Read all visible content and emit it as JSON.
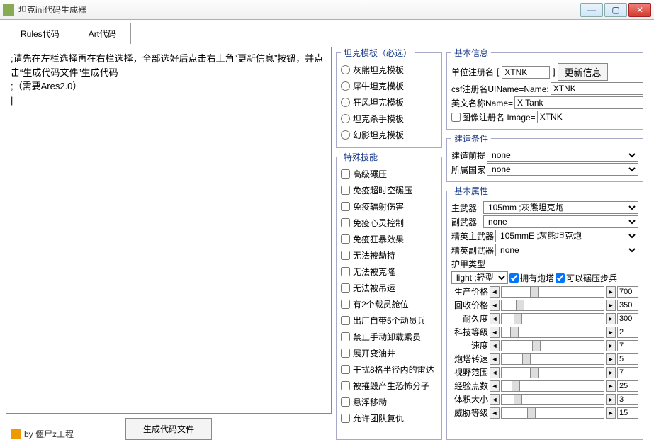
{
  "window": {
    "title": "坦克ini代码生成器"
  },
  "tabs": [
    "Rules代码",
    "Art代码"
  ],
  "editor_text": ";请先在左栏选择再在右栏选择，全部选好后点击右上角“更新信息”按钮，并点击“生成代码文件”生成代码\n;（需要Ares2.0）\n|",
  "generate_btn": "生成代码文件",
  "byline": "by 僵尸z工程",
  "templates": {
    "legend": "坦克模板（必选）",
    "items": [
      "灰熊坦克模板",
      "犀牛坦克模板",
      "狂风坦克模板",
      "坦克杀手模板",
      "幻影坦克模板"
    ]
  },
  "skills": {
    "legend": "特殊技能",
    "items": [
      "高级碾压",
      "免疫超时空碾压",
      "免疫辐射伤害",
      "免疫心灵控制",
      "免疫狂暴效果",
      "无法被劫持",
      "无法被克隆",
      "无法被吊运",
      "有2个载员舱位",
      "出厂自带5个动员兵",
      "禁止手动卸载乘员",
      "展开变油井",
      "干扰8格半径内的雷达",
      "被摧毁产生恐怖分子",
      "悬浮移动",
      "允许团队复仇"
    ]
  },
  "basic": {
    "legend": "基本信息",
    "reg_label": "单位注册名",
    "reg_value": "XTNK",
    "update_btn": "更新信息",
    "csf_label": "csf注册名UIName=Name:",
    "csf_value": "XTNK",
    "en_label": "英文名称Name=",
    "en_value": "X Tank",
    "img_chk": "图像注册名  Image=",
    "img_value": "XTNK"
  },
  "build": {
    "legend": "建造条件",
    "prereq_label": "建造前提",
    "prereq_value": "none",
    "owner_label": "所属国家",
    "owner_value": "none"
  },
  "attrs": {
    "legend": "基本属性",
    "primary_label": "主武器",
    "primary_value": "105mm ;灰熊坦克炮",
    "secondary_label": "副武器",
    "secondary_value": "none",
    "elite_primary_label": "精英主武器",
    "elite_primary_value": "105mmE ;灰熊坦克炮",
    "elite_secondary_label": "精英副武器",
    "elite_secondary_value": "none",
    "armor_label": "护甲类型",
    "armor_value": "light ;轻型",
    "turret_chk": "拥有炮塔",
    "crush_chk": "可以碾压步兵",
    "sliders": [
      {
        "label": "生产价格",
        "value": "700",
        "thumb": 28
      },
      {
        "label": "回收价格",
        "value": "350",
        "thumb": 14
      },
      {
        "label": "耐久度",
        "value": "300",
        "thumb": 12
      },
      {
        "label": "科技等级",
        "value": "2",
        "thumb": 8
      },
      {
        "label": "速度",
        "value": "7",
        "thumb": 30
      },
      {
        "label": "炮塔转速",
        "value": "5",
        "thumb": 20
      },
      {
        "label": "视野范围",
        "value": "7",
        "thumb": 28
      },
      {
        "label": "经验点数",
        "value": "25",
        "thumb": 10
      },
      {
        "label": "体积大小",
        "value": "3",
        "thumb": 12
      },
      {
        "label": "威胁等级",
        "value": "15",
        "thumb": 25
      }
    ]
  }
}
